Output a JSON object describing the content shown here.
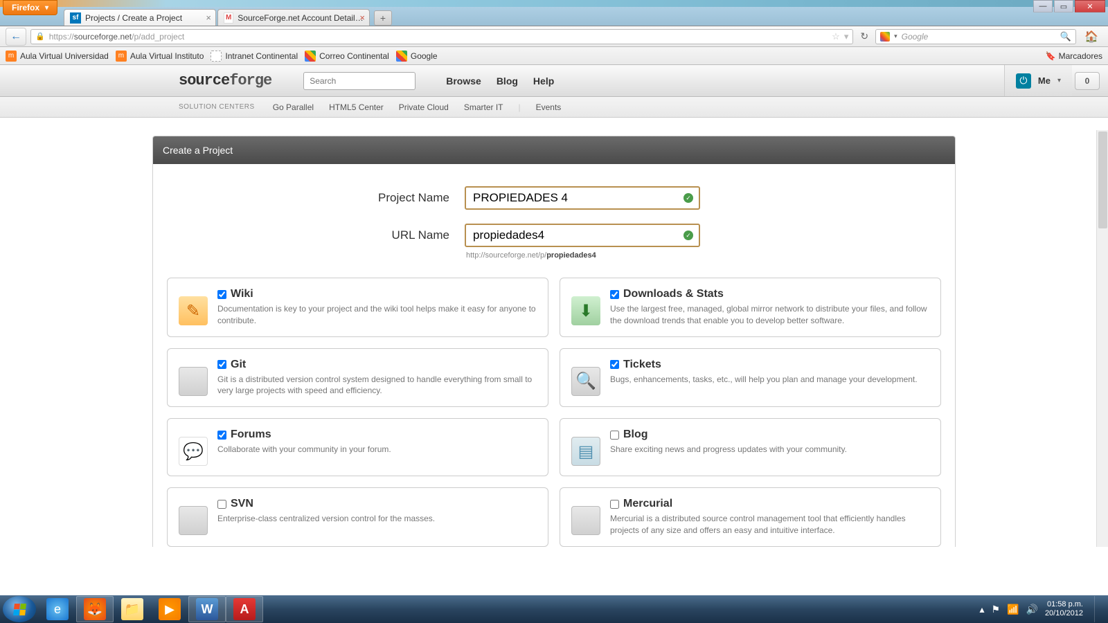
{
  "browser": {
    "app_button": "Firefox",
    "tabs": [
      {
        "title": "Projects / Create a Project",
        "favicon": "sf"
      },
      {
        "title": "SourceForge.net Account Details: ink...",
        "favicon": "gmail"
      }
    ],
    "url": "https://sourceforge.net/p/add_project",
    "search_placeholder": "Google",
    "bookmarks": [
      "Aula Virtual Universidad",
      "Aula Virtual Instituto",
      "Intranet Continental",
      "Correo Continental",
      "Google"
    ],
    "bookmarks_right": "Marcadores"
  },
  "sf": {
    "logo": "sourceforge",
    "search_placeholder": "Search",
    "nav": {
      "browse": "Browse",
      "blog": "Blog",
      "help": "Help"
    },
    "me_label": "Me",
    "notif_count": "0",
    "subnav_label": "SOLUTION CENTERS",
    "subnav": [
      "Go Parallel",
      "HTML5 Center",
      "Private Cloud",
      "Smarter IT"
    ],
    "subnav_right": "Events"
  },
  "form": {
    "panel_title": "Create a Project",
    "project_name_label": "Project Name",
    "project_name_value": "PROPIEDADES 4",
    "url_name_label": "URL Name",
    "url_name_value": "propiedades4",
    "url_hint_prefix": "http://sourceforge.net/p/",
    "url_hint_bold": "propiedades4"
  },
  "tools": [
    {
      "key": "wiki",
      "checked": true,
      "title": "Wiki",
      "desc": "Documentation is key to your project and the wiki tool helps make it easy for anyone to contribute.",
      "icon": "wiki"
    },
    {
      "key": "downloads",
      "checked": true,
      "title": "Downloads & Stats",
      "desc": "Use the largest free, managed, global mirror network to distribute your files, and follow the download trends that enable you to develop better software.",
      "icon": "dl"
    },
    {
      "key": "git",
      "checked": true,
      "title": "Git",
      "desc": "Git is a distributed version control system designed to handle everything from small to very large projects with speed and efficiency.",
      "icon": "code"
    },
    {
      "key": "tickets",
      "checked": true,
      "title": "Tickets",
      "desc": "Bugs, enhancements, tasks, etc., will help you plan and manage your development.",
      "icon": "tix"
    },
    {
      "key": "forums",
      "checked": true,
      "title": "Forums",
      "desc": "Collaborate with your community in your forum.",
      "icon": "forum"
    },
    {
      "key": "blog",
      "checked": false,
      "title": "Blog",
      "desc": "Share exciting news and progress updates with your community.",
      "icon": "blog"
    },
    {
      "key": "svn",
      "checked": false,
      "title": "SVN",
      "desc": "Enterprise-class centralized version control for the masses.",
      "icon": "code"
    },
    {
      "key": "mercurial",
      "checked": false,
      "title": "Mercurial",
      "desc": "Mercurial is a distributed source control management tool that efficiently handles projects of any size and offers an easy and intuitive interface.",
      "icon": "code"
    }
  ],
  "taskbar": {
    "time": "01:58 p.m.",
    "date": "20/10/2012"
  }
}
